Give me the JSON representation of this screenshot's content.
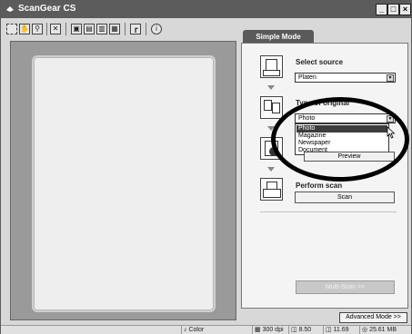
{
  "window": {
    "title": "ScanGear CS"
  },
  "toolbar": {
    "tools": [
      "marquee-tool",
      "hand-tool",
      "zoom-tool",
      "fit-tool",
      "crop-tool-1",
      "crop-tool-2",
      "crop-tool-3",
      "crop-tool-4",
      "rotate-tool",
      "info-tool"
    ]
  },
  "tabs": {
    "simple_mode": "Simple Mode"
  },
  "steps": {
    "select_source": {
      "label": "Select source",
      "value": "Platen"
    },
    "type_of_original": {
      "label": "Type of original",
      "value": "Photo",
      "options": [
        "Photo",
        "Magazine",
        "Newspaper",
        "Document"
      ],
      "selected_index": 0
    },
    "preview": {
      "button": "Preview"
    },
    "perform_scan": {
      "label": "Perform scan",
      "button": "Scan"
    }
  },
  "multi_scan_button": "Multi-Scan >>",
  "advanced_mode_button": "Advanced Mode >>",
  "status": {
    "color_mode": "Color",
    "resolution": "300 dpi",
    "width": "8.50",
    "height": "11.69",
    "size": "25.61 MB"
  }
}
